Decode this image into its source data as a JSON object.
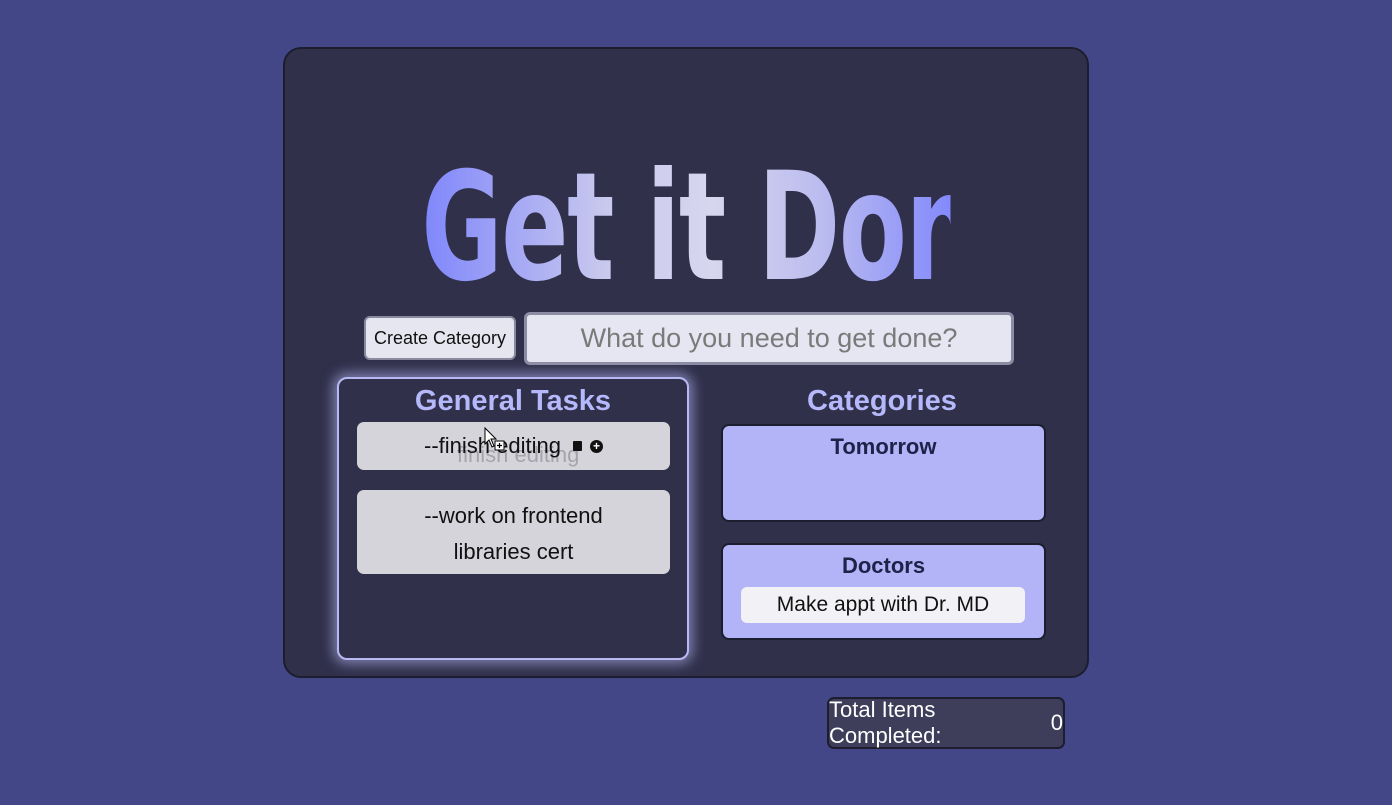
{
  "app": {
    "title": "Get it Done!"
  },
  "toolbar": {
    "create_category_label": "Create Category",
    "task_input_placeholder": "What do you need to get done?",
    "task_input_value": ""
  },
  "general_tasks": {
    "heading": "General Tasks",
    "items": [
      {
        "text": "--finish editing",
        "icons": [
          "trash-icon",
          "add-circle-icon"
        ]
      },
      {
        "text": "--work on frontend libraries cert"
      }
    ],
    "drag_ghost_text": "finish editing"
  },
  "categories": {
    "heading": "Categories",
    "items": [
      {
        "title": "Tomorrow",
        "tasks": []
      },
      {
        "title": "Doctors",
        "tasks": [
          "Make appt with Dr. MD"
        ]
      }
    ]
  },
  "footer": {
    "total_label": "Total Items Completed:",
    "total_value": "0"
  },
  "colors": {
    "page_background": "#434787",
    "card_background": "#30304b",
    "accent": "#b5b8fb",
    "category_card": "#b3b4f8",
    "task_item": "#d4d4da"
  }
}
